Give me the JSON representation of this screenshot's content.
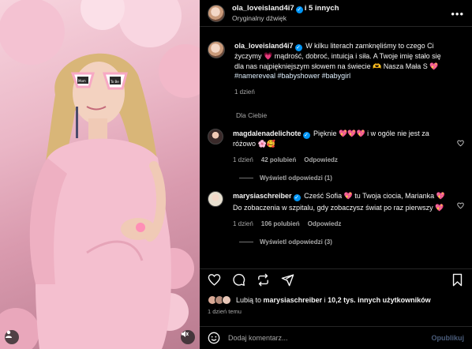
{
  "header": {
    "username": "ola_loveisland4i7",
    "collab_text": "i 5 innych",
    "audio": "Oryginalny dźwięk"
  },
  "caption": {
    "username": "ola_loveisland4i7",
    "text": "W kilku literach zamknęliśmy to czego Ci życzymy 💗 mądrość, dobroć, intuicja i siła. A Twoje imię stało się dla nas najpiękniejszym słowem na świecie 🫶 Nasza Mała S 💖",
    "hashtags": "#namereveal #babyshower #babygirl",
    "time": "1 dzień"
  },
  "section_label": "Dla Ciebie",
  "comments": [
    {
      "username": "magdalenadelichote",
      "text": "Pięknie 💖💖💖 i w ogóle nie jest za różowo 🌸🥰",
      "time": "1 dzień",
      "likes": "42 polubień",
      "reply": "Odpowiedz",
      "thread": "Wyświetl odpowiedzi (1)"
    },
    {
      "username": "marysiaschreiber",
      "text": "Cześć Sofia 💖 tu Twoja ciocia, Marianka 💖",
      "text2": "Do zobaczenia w szpitalu, gdy zobaczysz świat po raz pierwszy 💖",
      "time": "1 dzień",
      "likes": "106 polubień",
      "reply": "Odpowiedz",
      "thread": "Wyświetl odpowiedzi (3)"
    }
  ],
  "likes": {
    "prefix": "Lubią to",
    "user": "marysiaschreiber",
    "middle": "i",
    "rest": "10,2 tys. innych użytkowników"
  },
  "post_time": "1 dzień temu",
  "composer": {
    "placeholder": "Dodaj komentarz...",
    "publish": "Opublikuj"
  },
  "photo": {
    "sunglasses_text": "Mom To Be"
  },
  "colors": {
    "verified": "#0095f6",
    "like_red": "#ff3040",
    "muted": "#a8a8a8"
  }
}
